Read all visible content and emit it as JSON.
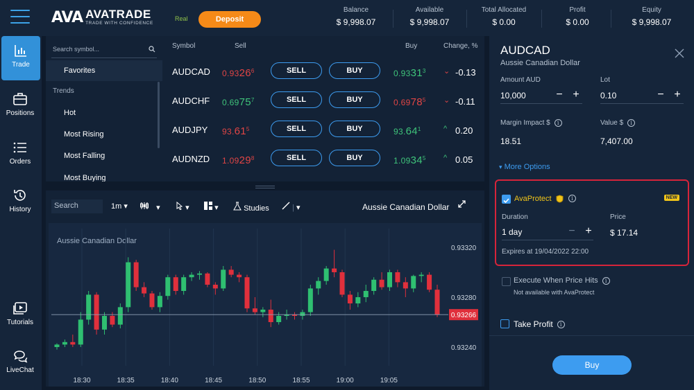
{
  "header": {
    "logo_mark": "AVA",
    "logo_name": "AVATRADE",
    "logo_tagline": "TRADE WITH CONFIDENCE",
    "account_type": "Real",
    "deposit_label": "Deposit",
    "stats": [
      {
        "label": "Balance",
        "value": "$ 9,998.07"
      },
      {
        "label": "Available",
        "value": "$ 9,998.07"
      },
      {
        "label": "Total Allocated",
        "value": "$ 0.00"
      },
      {
        "label": "Profit",
        "value": "$ 0.00"
      },
      {
        "label": "Equity",
        "value": "$ 9,998.07"
      }
    ]
  },
  "nav": {
    "items": [
      {
        "label": "Trade",
        "icon": "chart-bars-icon",
        "active": true
      },
      {
        "label": "Positions",
        "icon": "briefcase-icon"
      },
      {
        "label": "Orders",
        "icon": "list-icon"
      },
      {
        "label": "History",
        "icon": "history-icon"
      },
      {
        "label": "Tutorials",
        "icon": "video-icon"
      },
      {
        "label": "LiveChat",
        "icon": "chat-icon"
      }
    ]
  },
  "symbols": {
    "search_placeholder": "Search symbol...",
    "favorites": "Favorites",
    "trends_heading": "Trends",
    "trends": [
      "Hot",
      "Most Rising",
      "Most Falling",
      "Most Buying"
    ]
  },
  "quotes": {
    "headers": {
      "symbol": "Symbol",
      "sell": "Sell",
      "buy": "Buy",
      "change": "Change, %"
    },
    "sell_label": "SELL",
    "buy_label": "BUY",
    "rows": [
      {
        "symbol": "AUDCAD",
        "sell_a": "0.93",
        "sell_b": "26",
        "sell_c": "6",
        "sell_color": "red",
        "buy_a": "0.93",
        "buy_b": "31",
        "buy_c": "3",
        "buy_color": "green",
        "arrow": "⌄",
        "arrow_color": "red",
        "change": "-0.13"
      },
      {
        "symbol": "AUDCHF",
        "sell_a": "0.69",
        "sell_b": "75",
        "sell_c": "7",
        "sell_color": "green",
        "buy_a": "0.69",
        "buy_b": "78",
        "buy_c": "5",
        "buy_color": "red",
        "arrow": "⌄",
        "arrow_color": "red",
        "change": "-0.11"
      },
      {
        "symbol": "AUDJPY",
        "sell_a": "93.",
        "sell_b": "61",
        "sell_c": "5",
        "sell_color": "red",
        "buy_a": "93.",
        "buy_b": "64",
        "buy_c": "1",
        "buy_color": "green",
        "arrow": "^",
        "arrow_color": "green",
        "change": "0.20"
      },
      {
        "symbol": "AUDNZD",
        "sell_a": "1.09",
        "sell_b": "29",
        "sell_c": "8",
        "sell_color": "red",
        "buy_a": "1.09",
        "buy_b": "34",
        "buy_c": "5",
        "buy_color": "green",
        "arrow": "^",
        "arrow_color": "green",
        "change": "0.05"
      }
    ]
  },
  "chart_toolbar": {
    "search_placeholder": "Search",
    "timeframe": "1m",
    "studies_label": "Studies",
    "title": "Aussie Canadian Dollar"
  },
  "chart_data": {
    "type": "candlestick",
    "title": "Aussie Canadian Dollar",
    "xlabel": "",
    "ylabel": "",
    "x_ticks": [
      "18:30",
      "18:35",
      "18:40",
      "18:45",
      "18:50",
      "18:55",
      "19:00",
      "19:05"
    ],
    "y_ticks": [
      "0.93320",
      "0.93280",
      "0.93240"
    ],
    "ylim": [
      0.93225,
      0.93335
    ],
    "last_price": "0.93266",
    "up_color": "#2fbf71",
    "down_color": "#e0303c",
    "candles": [
      [
        0.9324,
        0.93243,
        0.93238,
        0.93242
      ],
      [
        0.93242,
        0.93246,
        0.9324,
        0.93244
      ],
      [
        0.93244,
        0.9325,
        0.9324,
        0.93242
      ],
      [
        0.93242,
        0.93268,
        0.9324,
        0.93262
      ],
      [
        0.93262,
        0.93285,
        0.93258,
        0.93282
      ],
      [
        0.93282,
        0.93284,
        0.9325,
        0.93254
      ],
      [
        0.93254,
        0.93268,
        0.9325,
        0.93265
      ],
      [
        0.93265,
        0.93268,
        0.93256,
        0.93258
      ],
      [
        0.93258,
        0.93275,
        0.93255,
        0.93272
      ],
      [
        0.93272,
        0.93312,
        0.93268,
        0.93308
      ],
      [
        0.93308,
        0.9331,
        0.93285,
        0.93288
      ],
      [
        0.93288,
        0.93292,
        0.9328,
        0.93283
      ],
      [
        0.93283,
        0.93285,
        0.9327,
        0.93272
      ],
      [
        0.93272,
        0.93284,
        0.93268,
        0.93281
      ],
      [
        0.93281,
        0.93298,
        0.93278,
        0.93296
      ],
      [
        0.93296,
        0.93298,
        0.93282,
        0.93285
      ],
      [
        0.93285,
        0.93298,
        0.93282,
        0.93296
      ],
      [
        0.93296,
        0.933,
        0.93293,
        0.93298
      ],
      [
        0.93298,
        0.93301,
        0.93294,
        0.93299
      ],
      [
        0.93299,
        0.933,
        0.93288,
        0.9329
      ],
      [
        0.9329,
        0.93292,
        0.93282,
        0.93287
      ],
      [
        0.93287,
        0.93305,
        0.93285,
        0.93302
      ],
      [
        0.93302,
        0.93305,
        0.93296,
        0.93298
      ],
      [
        0.93298,
        0.933,
        0.93292,
        0.93296
      ],
      [
        0.93296,
        0.93298,
        0.93268,
        0.93271
      ],
      [
        0.93271,
        0.9328,
        0.93266,
        0.93268
      ],
      [
        0.93268,
        0.93272,
        0.93264,
        0.9327
      ],
      [
        0.9327,
        0.93278,
        0.93256,
        0.9326
      ],
      [
        0.9326,
        0.93268,
        0.93258,
        0.93265
      ],
      [
        0.93265,
        0.9327,
        0.93262,
        0.93266
      ],
      [
        0.93266,
        0.93268,
        0.93262,
        0.93265
      ],
      [
        0.93265,
        0.9327,
        0.93262,
        0.93268
      ],
      [
        0.93268,
        0.9329,
        0.93265,
        0.93287
      ],
      [
        0.93287,
        0.93296,
        0.93282,
        0.93293
      ],
      [
        0.93293,
        0.93305,
        0.9329,
        0.93303
      ],
      [
        0.93303,
        0.93318,
        0.93296,
        0.933
      ],
      [
        0.933,
        0.93302,
        0.9328,
        0.93282
      ],
      [
        0.93282,
        0.93285,
        0.9327,
        0.93275
      ],
      [
        0.93275,
        0.93284,
        0.93272,
        0.9328
      ],
      [
        0.9328,
        0.9329,
        0.93276,
        0.93285
      ],
      [
        0.93285,
        0.93296,
        0.93282,
        0.93294
      ],
      [
        0.93294,
        0.933,
        0.93286,
        0.93288
      ],
      [
        0.93288,
        0.93302,
        0.93285,
        0.933
      ],
      [
        0.933,
        0.93302,
        0.93288,
        0.93292
      ],
      [
        0.93292,
        0.93296,
        0.9328,
        0.93287
      ],
      [
        0.93287,
        0.93298,
        0.93284,
        0.93297
      ],
      [
        0.93297,
        0.933,
        0.93292,
        0.93298
      ],
      [
        0.93298,
        0.933,
        0.93284,
        0.93286
      ],
      [
        0.93286,
        0.9329,
        0.93264,
        0.93266
      ]
    ]
  },
  "order": {
    "symbol": "AUDCAD",
    "name": "Aussie Canadian Dollar",
    "amount_label": "Amount AUD",
    "amount_value": "10,000",
    "lot_label": "Lot",
    "lot_value": "0.10",
    "margin_label": "Margin Impact $",
    "margin_value": "18.51",
    "value_label": "Value $",
    "value_value": "7,407.00",
    "more_options": "More Options",
    "avaprotect_label": "AvaProtect",
    "new_badge": "NEW",
    "duration_label": "Duration",
    "duration_value": "1 day",
    "price_label": "Price",
    "price_value": "$ 17.14",
    "expires": "Expires at 19/04/2022 22:00",
    "execute_label": "Execute When Price Hits",
    "execute_note": "Not available with AvaProtect",
    "take_profit_label": "Take Profit",
    "buy_label": "Buy"
  }
}
